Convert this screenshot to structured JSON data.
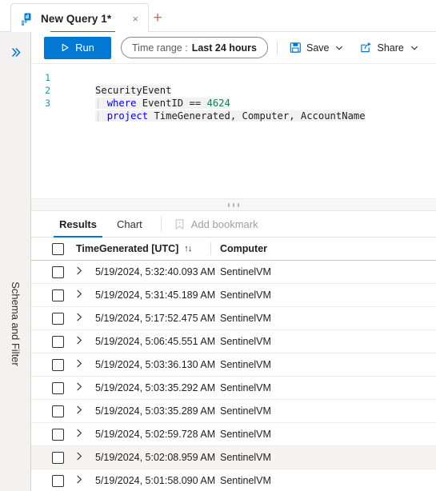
{
  "tab": {
    "icon": "query-analytics-icon",
    "label": "New Query 1*",
    "close_label": "×",
    "new_tab_label": "+"
  },
  "rail": {
    "expand_icon": "double-chevron-right-icon",
    "label": "Schema and Filter"
  },
  "toolbar": {
    "run_label": "Run",
    "run_icon": "play-icon",
    "time_range_key": "Time range :",
    "time_range_value": "Last 24 hours",
    "save_label": "Save",
    "save_icon": "save-floppy-icon",
    "share_label": "Share",
    "share_icon": "share-arrow-icon",
    "caret_icon": "chevron-down-icon"
  },
  "editor": {
    "lines": [
      {
        "num": "1",
        "text": "SecurityEvent"
      },
      {
        "num": "2",
        "text": "| where EventID == 4624"
      },
      {
        "num": "3",
        "text": "| project TimeGenerated, Computer, AccountName"
      }
    ],
    "tokens": {
      "table": "SecurityEvent",
      "pipe": "|",
      "where": "where",
      "eventid": "EventID",
      "equals": "==",
      "number": "4624",
      "project": "project",
      "columns": "TimeGenerated, Computer, AccountName"
    }
  },
  "splitter": {
    "grip_icon": "drag-handle-icon"
  },
  "results": {
    "tabs": [
      {
        "label": "Results",
        "active": true
      },
      {
        "label": "Chart",
        "active": false
      }
    ],
    "bookmark": {
      "icon": "bookmark-icon",
      "label": "Add bookmark",
      "disabled": true
    },
    "columns": [
      {
        "label": "TimeGenerated [UTC]",
        "sort_icon": "↑↓"
      },
      {
        "label": "Computer"
      }
    ],
    "rows": [
      {
        "time": "5/19/2024, 5:32:40.093 AM",
        "computer": "SentinelVM",
        "hovered": false
      },
      {
        "time": "5/19/2024, 5:31:45.189 AM",
        "computer": "SentinelVM",
        "hovered": false
      },
      {
        "time": "5/19/2024, 5:17:52.475 AM",
        "computer": "SentinelVM",
        "hovered": false
      },
      {
        "time": "5/19/2024, 5:06:45.551 AM",
        "computer": "SentinelVM",
        "hovered": false
      },
      {
        "time": "5/19/2024, 5:03:36.130 AM",
        "computer": "SentinelVM",
        "hovered": false
      },
      {
        "time": "5/19/2024, 5:03:35.292 AM",
        "computer": "SentinelVM",
        "hovered": false
      },
      {
        "time": "5/19/2024, 5:03:35.289 AM",
        "computer": "SentinelVM",
        "hovered": false
      },
      {
        "time": "5/19/2024, 5:02:59.728 AM",
        "computer": "SentinelVM",
        "hovered": false
      },
      {
        "time": "5/19/2024, 5:02:08.959 AM",
        "computer": "SentinelVM",
        "hovered": true
      },
      {
        "time": "5/19/2024, 5:01:58.090 AM",
        "computer": "SentinelVM",
        "hovered": false
      }
    ],
    "expand_icon": "chevron-right-icon",
    "checkbox_icon": "checkbox-unchecked-icon"
  },
  "colors": {
    "accent": "#0078d4",
    "rail_bg": "#f3f2f1",
    "border": "#e1dfdd",
    "text": "#201f1e",
    "muted": "#a19f9d",
    "keyword": "#0000ff",
    "number": "#098658",
    "linenum": "#2b91af",
    "row_hover": "#f5f4f3"
  }
}
